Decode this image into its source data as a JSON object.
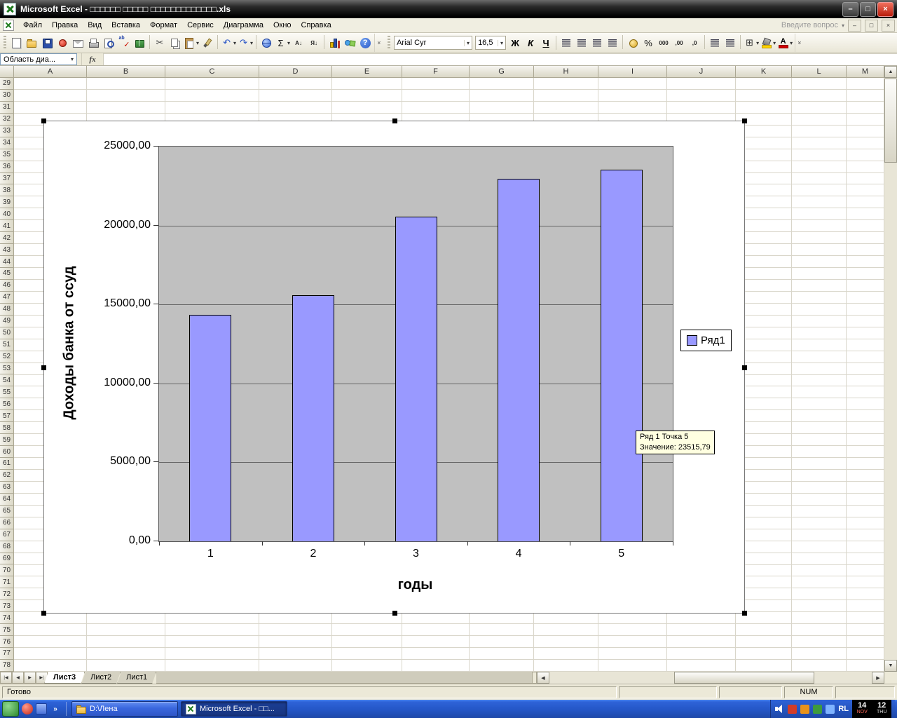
{
  "glyphs": {
    "dropdown": "▾",
    "up": "▲",
    "down": "▼",
    "left": "◀",
    "right": "▶",
    "more": "»"
  },
  "window": {
    "title": "Microsoft Excel - □□□□□□ □□□□□ □□□□□□□□□□□□□.xls",
    "minimize_glyph": "–",
    "maximize_glyph": "□",
    "close_glyph": "×"
  },
  "menu_bar": {
    "items": [
      "Файл",
      "Правка",
      "Вид",
      "Вставка",
      "Формат",
      "Сервис",
      "Диаграмма",
      "Окно",
      "Справка"
    ],
    "question_box": "Введите вопрос",
    "win_minimize": "–",
    "win_restore": "□",
    "win_close": "×"
  },
  "standard_toolbar": {
    "icons": [
      {
        "n": "new-document-icon",
        "k": "page"
      },
      {
        "n": "open-folder-icon",
        "k": "folder"
      },
      {
        "n": "save-icon",
        "k": "disk"
      },
      {
        "n": "permission-icon",
        "k": "perm"
      },
      {
        "n": "mail-icon",
        "k": "mail"
      },
      {
        "n": "print-icon",
        "k": "print"
      },
      {
        "n": "print-preview-icon",
        "k": "preview"
      },
      {
        "n": "spelling-icon",
        "k": "spell",
        "g": "✓",
        "c": "#CC1100"
      },
      {
        "n": "research-icon",
        "k": "book"
      },
      {
        "sep": true
      },
      {
        "n": "cut-icon",
        "g": "✂",
        "c": "#444444"
      },
      {
        "n": "copy-icon",
        "k": "copy"
      },
      {
        "n": "paste-icon",
        "k": "paste",
        "dd": true
      },
      {
        "n": "format-painter-icon",
        "k": "painter"
      },
      {
        "sep": true
      },
      {
        "n": "undo-icon",
        "g": "↶",
        "c": "#2A56C6",
        "dd": true
      },
      {
        "n": "redo-icon",
        "g": "↷",
        "c": "#2A56C6",
        "dd": true
      },
      {
        "sep": true
      },
      {
        "n": "hyperlink-icon",
        "k": "link"
      },
      {
        "n": "autosum-icon",
        "g": "Σ",
        "c": "#111111",
        "dd": true
      },
      {
        "n": "sort-ascending-icon",
        "k": "small",
        "g": "А↓"
      },
      {
        "n": "sort-descending-icon",
        "k": "small",
        "g": "Я↓"
      },
      {
        "sep": true
      },
      {
        "n": "chart-wizard-icon",
        "k": "chart"
      },
      {
        "n": "drawing-icon",
        "k": "draw"
      },
      {
        "n": "help-icon",
        "k": "help",
        "g": "?"
      }
    ]
  },
  "formatting_toolbar": {
    "font_name": "Arial Cyr",
    "font_size": "16,5",
    "bold_label": "Ж",
    "italic_label": "К",
    "underline_label": "Ч",
    "icons": [
      {
        "n": "align-left-icon",
        "k": "al"
      },
      {
        "n": "align-center-icon",
        "k": "al"
      },
      {
        "n": "align-right-icon",
        "k": "al"
      },
      {
        "n": "merge-center-icon",
        "k": "al"
      },
      {
        "sep": true
      },
      {
        "n": "currency-icon",
        "k": "coin"
      },
      {
        "n": "percent-icon",
        "g": "%",
        "c": "#111111"
      },
      {
        "n": "thousands-icon",
        "k": "small",
        "g": "000"
      },
      {
        "n": "increase-decimal-icon",
        "k": "small",
        "g": ",00"
      },
      {
        "n": "decrease-decimal-icon",
        "k": "small",
        "g": ",0"
      },
      {
        "sep": true
      },
      {
        "n": "decrease-indent-icon",
        "k": "al"
      },
      {
        "n": "increase-indent-icon",
        "k": "al"
      },
      {
        "sep": true
      },
      {
        "n": "borders-icon",
        "g": "⊞",
        "c": "#333333",
        "dd": true
      },
      {
        "n": "fill-color-icon",
        "k": "fill",
        "dd": true
      },
      {
        "n": "font-color-icon",
        "k": "fontcolor",
        "g": "А",
        "dd": true
      }
    ]
  },
  "formula_bar": {
    "name_box": "Область диа...",
    "fx_label": "fx",
    "formula_value": ""
  },
  "grid": {
    "columns": [
      "A",
      "B",
      "C",
      "D",
      "E",
      "F",
      "G",
      "H",
      "I",
      "J",
      "K",
      "L",
      "M"
    ],
    "row_start": 29,
    "row_end": 78
  },
  "chart_data": {
    "type": "bar",
    "categories": [
      "1",
      "2",
      "3",
      "4",
      "5"
    ],
    "values": [
      14350,
      15600,
      20550,
      22950,
      23515.79
    ],
    "title": "",
    "xlabel": "годы",
    "ylabel": "Доходы банка от ссуд",
    "ylim": [
      0,
      25000
    ],
    "ytick_interval": 5000,
    "ytick_labels": [
      "25000,00",
      "20000,00",
      "15000,00",
      "10000,00",
      "5000,00",
      "0,00"
    ],
    "legend": [
      "Ряд1"
    ],
    "legend_position": "right",
    "grid": true,
    "bar_color": "#9999FF",
    "plot_bg": "#C0C0C0",
    "tooltip": {
      "line1": "Ряд 1 Точка 5",
      "line2": "Значение: 23515,79"
    }
  },
  "sheet_tabs": {
    "nav": [
      "|◀",
      "◀",
      "▶",
      "▶|"
    ],
    "tabs": [
      "Лист3",
      "Лист2",
      "Лист1"
    ],
    "active": "Лист3"
  },
  "status_bar": {
    "mode": "Готово",
    "num": "NUM"
  },
  "taskbar": {
    "buttons": [
      {
        "label": "D:\\Лена",
        "icon": "folder",
        "active": false
      },
      {
        "label": "Microsoft Excel - □□...",
        "icon": "excel",
        "active": true
      }
    ],
    "tray": {
      "lang": "RL",
      "clock": [
        {
          "big": "14",
          "small": "NOV"
        },
        {
          "big": "12",
          "small": "THU"
        }
      ]
    }
  }
}
